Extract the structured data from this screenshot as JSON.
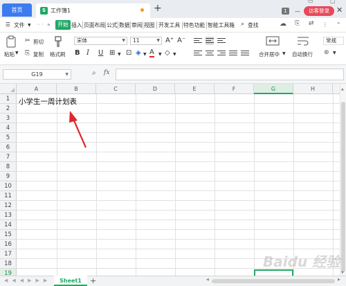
{
  "titlebar": {
    "home_tab": "首页",
    "doc_logo": "S",
    "doc_title": "工作簿1",
    "new_tab": "+",
    "badge": "1",
    "visitor_login": "访客登录"
  },
  "menubar": {
    "file": "文件",
    "items": [
      "开始",
      "插入",
      "页面布局",
      "公式",
      "数据",
      "审阅",
      "视图",
      "开发工具",
      "特色功能",
      "智能工具箱"
    ],
    "search": "查找"
  },
  "ribbon": {
    "paste": "粘贴",
    "cut": "剪切",
    "copy": "复制",
    "format_painter": "格式刷",
    "font_name": "宋体",
    "font_size": "11",
    "merge_center": "合并居中",
    "wrap_text": "自动换行",
    "number_format": "常规",
    "bold": "B",
    "italic": "I",
    "underline": "U"
  },
  "formula_bar": {
    "name_box": "G19",
    "fx": "fx",
    "formula": ""
  },
  "grid": {
    "columns": [
      "A",
      "B",
      "C",
      "D",
      "E",
      "F",
      "G",
      "H"
    ],
    "selected_column": "G",
    "rows": [
      "1",
      "2",
      "3",
      "4",
      "5",
      "6",
      "7",
      "8",
      "9",
      "10",
      "11",
      "12",
      "13",
      "14",
      "15",
      "16",
      "17",
      "18",
      "19"
    ],
    "cells": {
      "A1": "小学生一周计划表"
    }
  },
  "sheets": {
    "tabs": [
      "Sheet1"
    ],
    "add": "+"
  },
  "watermark": "Baidu 经验",
  "colors": {
    "accent_green": "#1fa865",
    "home_blue": "#3d7bf0",
    "login_red": "#e8495a",
    "arrow_red": "#e0282a"
  }
}
